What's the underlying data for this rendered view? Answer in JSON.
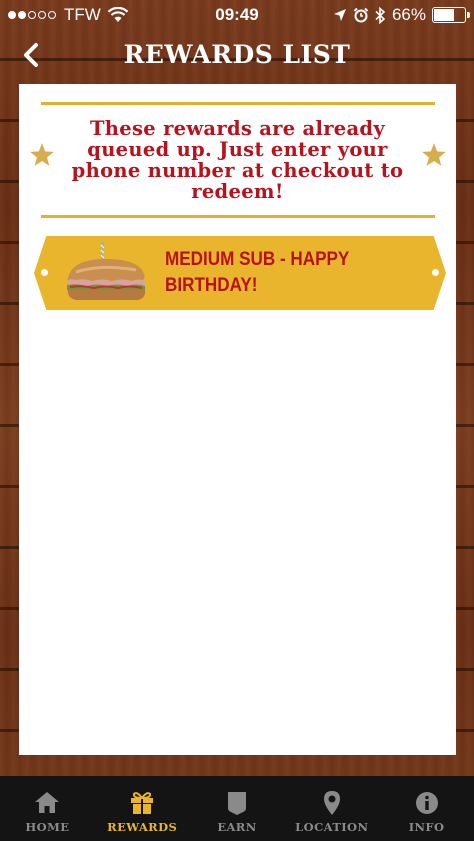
{
  "status_bar": {
    "carrier": "TFW",
    "time": "09:49",
    "battery": "66%",
    "battery_level": 0.66,
    "signal_bars": 2
  },
  "header": {
    "title": "REWARDS LIST",
    "back_icon": "chevron-left-icon"
  },
  "content": {
    "message": "These rewards are already queued up. Just enter your phone number at checkout to redeem!",
    "rewards": [
      {
        "label": "MEDIUM SUB - HAPPY BIRTHDAY!",
        "icon": "sandwich-with-candle-icon"
      }
    ]
  },
  "tabs": [
    {
      "label": "HOME",
      "icon": "home-icon",
      "active": false
    },
    {
      "label": "REWARDS",
      "icon": "gift-icon",
      "active": true
    },
    {
      "label": "EARN",
      "icon": "card-icon",
      "active": false
    },
    {
      "label": "LOCATION",
      "icon": "map-pin-icon",
      "active": false
    },
    {
      "label": "INFO",
      "icon": "info-icon",
      "active": false
    }
  ],
  "colors": {
    "accent_gold": "#e8b52c",
    "text_red": "#b8131c",
    "tab_bar_bg": "#141414",
    "wood": "#7a3a1c"
  }
}
